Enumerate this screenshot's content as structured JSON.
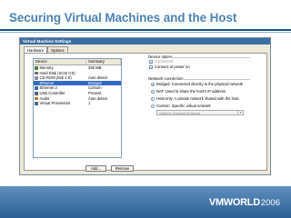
{
  "slide": {
    "title": "Securing Virtual Machines and the Host",
    "footer_brand": "VMWORLD",
    "footer_year": "2006"
  },
  "dialog": {
    "title": "Virtual Machine Settings",
    "tabs": [
      {
        "label": "Hardware",
        "active": true
      },
      {
        "label": "Options",
        "active": false
      }
    ],
    "device_table": {
      "headers": {
        "device": "Device",
        "summary": "Summary"
      },
      "rows": [
        {
          "icon": "memory-icon",
          "device": "Memory",
          "summary": "256 MB",
          "selected": false
        },
        {
          "icon": "hard-disk-icon",
          "device": "Hard Disk (SCSI 0:0)",
          "summary": "",
          "selected": false
        },
        {
          "icon": "cdrom-icon",
          "device": "CD-ROM (IDE 1:0)",
          "summary": "Auto detect",
          "selected": false
        },
        {
          "icon": "ethernet-icon",
          "device": "Ethernet",
          "summary": "Bridged",
          "selected": true
        },
        {
          "icon": "ethernet-icon",
          "device": "Ethernet 2",
          "summary": "Custom",
          "selected": false
        },
        {
          "icon": "usb-icon",
          "device": "USB Controller",
          "summary": "Present",
          "selected": false
        },
        {
          "icon": "audio-icon",
          "device": "Audio",
          "summary": "Auto detect",
          "selected": false
        },
        {
          "icon": "processor-icon",
          "device": "Virtual Processors",
          "summary": "1",
          "selected": false
        }
      ]
    },
    "buttons": {
      "add": "Add...",
      "remove": "Remove"
    },
    "device_status": {
      "title": "Device status",
      "connected": {
        "label": "Connected",
        "checked": true,
        "disabled": true
      },
      "connect_at_power_on": {
        "label": "Connect at power on",
        "checked": true
      }
    },
    "network_connection": {
      "title": "Network connection",
      "options": [
        {
          "label": "Bridged: Connected directly to the physical network",
          "selected": true
        },
        {
          "label": "NAT: Used to share the host's IP address",
          "selected": false
        },
        {
          "label": "Host-only: A private network shared with the host",
          "selected": false
        },
        {
          "label": "Custom: Specific virtual network",
          "selected": false
        }
      ],
      "custom_select_value": "VMnet0 (Default Bridged)"
    }
  }
}
